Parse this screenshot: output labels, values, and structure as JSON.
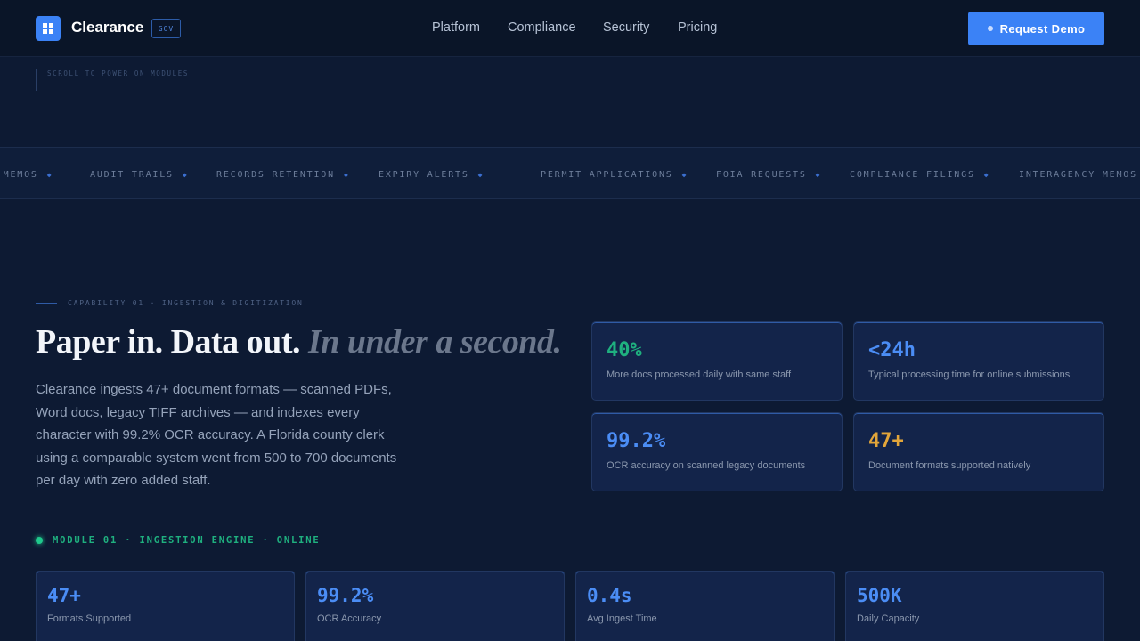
{
  "header": {
    "brand": "Clearance",
    "badge": "GOV",
    "nav": [
      "Platform",
      "Compliance",
      "Security",
      "Pricing"
    ],
    "cta_label": "Request Demo"
  },
  "scroll_hint": "SCROLL TO POWER ON MODULES",
  "marquee": {
    "items": [
      "Y MEMOS",
      "AUDIT TRAILS",
      "RECORDS RETENTION",
      "EXPIRY ALERTS",
      "PERMIT APPLICATIONS",
      "FOIA REQUESTS",
      "COMPLIANCE FILINGS",
      "INTERAGENCY MEMOS"
    ],
    "separator": "◆"
  },
  "capability": {
    "eyebrow": "CAPABILITY 01 · INGESTION & DIGITIZATION",
    "headline_main": "Paper in. Data out.",
    "headline_accent": "In under a second.",
    "body": "Clearance ingests 47+ document formats — scanned PDFs, Word docs, legacy TIFF archives — and indexes every character with 99.2% OCR accuracy. A Florida county clerk using a comparable system went from 500 to 700 documents per day with zero added staff."
  },
  "stats": [
    {
      "value": "40%",
      "label": "More docs processed daily with same staff",
      "color": "#1fb07f"
    },
    {
      "value": "<24h",
      "label": "Typical processing time for online submissions",
      "color": "#4b8df5"
    },
    {
      "value": "99.2%",
      "label": "OCR accuracy on scanned legacy documents",
      "color": "#4b8df5"
    },
    {
      "value": "47+",
      "label": "Document formats supported natively",
      "color": "#e3a63a"
    }
  ],
  "module": {
    "status": "MODULE 01 · INGESTION ENGINE · ONLINE"
  },
  "metrics": [
    {
      "value": "47+",
      "label": "Formats Supported"
    },
    {
      "value": "99.2%",
      "label": "OCR Accuracy"
    },
    {
      "value": "0.4s",
      "label": "Avg Ingest Time"
    },
    {
      "value": "500K",
      "label": "Daily Capacity"
    }
  ]
}
